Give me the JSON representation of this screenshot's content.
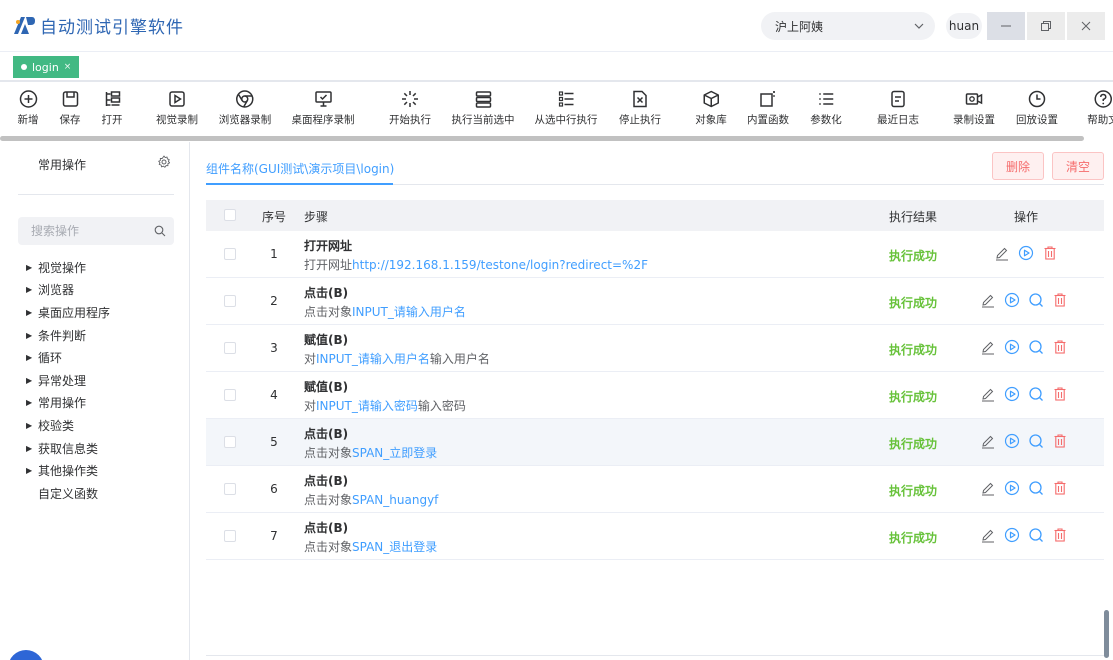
{
  "app": {
    "title": "自动测试引擎软件",
    "project": "沪上阿姨",
    "user": "huan",
    "window_controls": {
      "minimize": "—",
      "maximize": "❐",
      "close": "✕"
    }
  },
  "tabs": [
    {
      "label": "login",
      "close": "×"
    }
  ],
  "toolbar": [
    {
      "label": "新增",
      "icon": "plus-circle-icon"
    },
    {
      "label": "保存",
      "icon": "save-icon"
    },
    {
      "label": "打开",
      "icon": "open-tree-icon"
    },
    {
      "label": "视觉录制",
      "icon": "play-square-icon"
    },
    {
      "label": "浏览器录制",
      "icon": "chrome-icon"
    },
    {
      "label": "桌面程序录制",
      "icon": "monitor-icon"
    },
    {
      "label": "开始执行",
      "icon": "loading-icon"
    },
    {
      "label": "执行当前选中",
      "icon": "stack-icon"
    },
    {
      "label": "从选中行执行",
      "icon": "list-run-icon"
    },
    {
      "label": "停止执行",
      "icon": "stop-file-icon"
    },
    {
      "label": "对象库",
      "icon": "cube-icon"
    },
    {
      "label": "内置函数",
      "icon": "function-icon"
    },
    {
      "label": "参数化",
      "icon": "list-icon"
    },
    {
      "label": "最近日志",
      "icon": "log-icon"
    },
    {
      "label": "录制设置",
      "icon": "camera-icon"
    },
    {
      "label": "回放设置",
      "icon": "history-icon"
    },
    {
      "label": "帮助文",
      "icon": "help-icon"
    }
  ],
  "sidebar": {
    "title": "常用操作",
    "search_placeholder": "搜索操作",
    "items": [
      {
        "label": "视觉操作",
        "expandable": true
      },
      {
        "label": "浏览器",
        "expandable": true
      },
      {
        "label": "桌面应用程序",
        "expandable": true
      },
      {
        "label": "条件判断",
        "expandable": true
      },
      {
        "label": "循环",
        "expandable": true
      },
      {
        "label": "异常处理",
        "expandable": true
      },
      {
        "label": "常用操作",
        "expandable": true
      },
      {
        "label": "校验类",
        "expandable": true
      },
      {
        "label": "获取信息类",
        "expandable": true
      },
      {
        "label": "其他操作类",
        "expandable": true
      },
      {
        "label": "自定义函数",
        "expandable": false
      }
    ]
  },
  "main": {
    "component_tab": "组件名称(GUI测试\\演示项目\\login)",
    "delete_label": "删除",
    "clear_label": "清空",
    "columns": {
      "index": "序号",
      "step": "步骤",
      "result": "执行结果",
      "ops": "操作"
    },
    "rows": [
      {
        "num": "1",
        "title": "打开网址",
        "desc_prefix": "打开网址",
        "desc_obj": "http://192.168.1.159/testone/login?redirect=%2F",
        "desc_suffix": "",
        "result": "执行成功",
        "has_search": false,
        "highlight": false
      },
      {
        "num": "2",
        "title": "点击(B)",
        "desc_prefix": "点击对象",
        "desc_obj": "INPUT_请输入用户名",
        "desc_suffix": "",
        "result": "执行成功",
        "has_search": true,
        "highlight": false
      },
      {
        "num": "3",
        "title": "赋值(B)",
        "desc_prefix": "对",
        "desc_obj": "INPUT_请输入用户名",
        "desc_suffix": "输入用户名",
        "result": "执行成功",
        "has_search": true,
        "highlight": false
      },
      {
        "num": "4",
        "title": "赋值(B)",
        "desc_prefix": "对",
        "desc_obj": "INPUT_请输入密码",
        "desc_suffix": "输入密码",
        "result": "执行成功",
        "has_search": true,
        "highlight": false
      },
      {
        "num": "5",
        "title": "点击(B)",
        "desc_prefix": "点击对象",
        "desc_obj": "SPAN_立即登录",
        "desc_suffix": "",
        "result": "执行成功",
        "has_search": true,
        "highlight": true
      },
      {
        "num": "6",
        "title": "点击(B)",
        "desc_prefix": "点击对象",
        "desc_obj": "SPAN_huangyf",
        "desc_suffix": "",
        "result": "执行成功",
        "has_search": true,
        "highlight": false
      },
      {
        "num": "7",
        "title": "点击(B)",
        "desc_prefix": "点击对象",
        "desc_obj": "SPAN_退出登录",
        "desc_suffix": "",
        "result": "执行成功",
        "has_search": true,
        "highlight": false
      }
    ]
  },
  "colors": {
    "accent": "#409eff",
    "success": "#67c23a",
    "danger": "#f56c6c",
    "tag": "#42b983",
    "brand": "#2e66b3"
  }
}
